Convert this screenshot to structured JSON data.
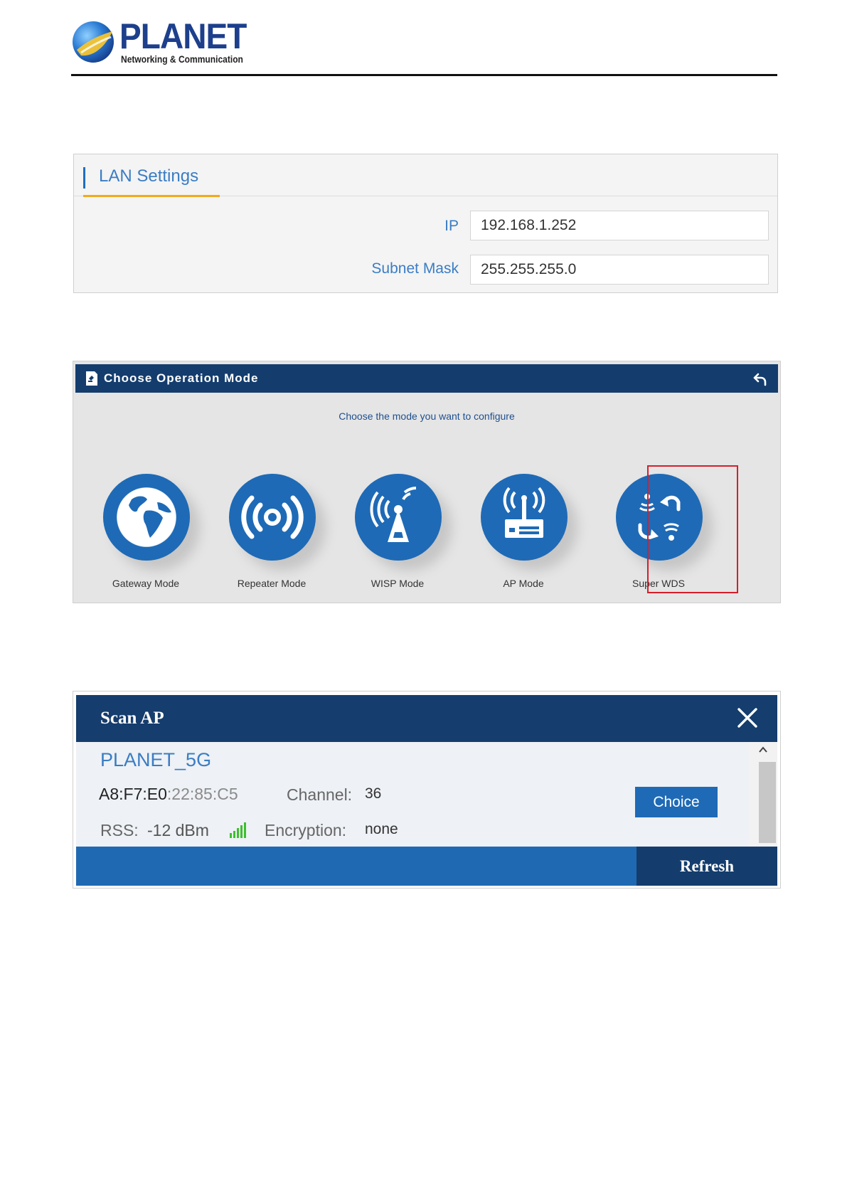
{
  "header": {
    "brand": "PLANET",
    "tagline": "Networking & Communication",
    "logo_icon": "globe-logo-icon"
  },
  "lan_settings": {
    "title": "LAN Settings",
    "fields": [
      {
        "label": "IP",
        "value": "192.168.1.252"
      },
      {
        "label": "Subnet Mask",
        "value": "255.255.255.0"
      }
    ]
  },
  "operation_mode": {
    "title": "Choose Operation Mode",
    "subtitle": "Choose the mode you want to configure",
    "modes": [
      {
        "label": "Gateway Mode",
        "icon": "globe-icon"
      },
      {
        "label": "Repeater Mode",
        "icon": "signal-broadcast-icon"
      },
      {
        "label": "WISP Mode",
        "icon": "antenna-tower-icon"
      },
      {
        "label": "AP Mode",
        "icon": "router-icon"
      },
      {
        "label": "Super WDS",
        "icon": "wds-exchange-icon",
        "selected": true
      }
    ],
    "colors": {
      "header": "#143d6e",
      "icon": "#1e6ab6",
      "highlight": "#d61f2a"
    }
  },
  "scan_ap": {
    "title": "Scan AP",
    "ssid": "PLANET_5G",
    "mac_prefix": "A8:F7:E0",
    "mac_suffix": ":22:85:C5",
    "channel_label": "Channel:",
    "channel_value": "36",
    "rss_label": "RSS:",
    "rss_value": "-12 dBm",
    "encryption_label": "Encryption:",
    "encryption_value": "none",
    "choice_label": "Choice",
    "refresh_label": "Refresh",
    "colors": {
      "header": "#153d6d",
      "button": "#1e6ab6",
      "signal": "#3cbf2e"
    }
  }
}
